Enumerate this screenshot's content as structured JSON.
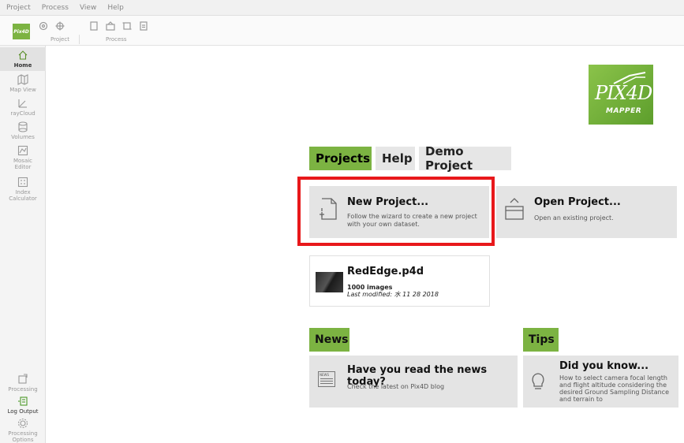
{
  "menubar": {
    "items": [
      "Project",
      "Process",
      "View",
      "Help"
    ]
  },
  "toolbar": {
    "groups": [
      {
        "label": "Project",
        "icons": [
          "tag-icon",
          "crosshair-icon"
        ]
      },
      {
        "label": "Process",
        "icons": [
          "page-icon",
          "folder-icon",
          "crop-icon",
          "report-icon"
        ]
      }
    ]
  },
  "sidebar": {
    "items": [
      {
        "label": "Home",
        "icon": "home-icon",
        "active": true
      },
      {
        "label": "Map View",
        "icon": "map-icon"
      },
      {
        "label": "rayCloud",
        "icon": "raycloud-icon"
      },
      {
        "label": "Volumes",
        "icon": "volume-icon"
      },
      {
        "label": "Mosaic Editor",
        "icon": "mosaic-icon"
      },
      {
        "label": "Index Calculator",
        "icon": "calculator-icon"
      }
    ],
    "bottom_items": [
      {
        "label": "Processing",
        "icon": "processing-icon"
      },
      {
        "label": "Log Output",
        "icon": "log-icon"
      },
      {
        "label": "Processing Options",
        "icon": "gear-icon"
      }
    ]
  },
  "logo": {
    "text": "PIX4D",
    "sub": "MAPPER",
    "color": "#7cb342"
  },
  "tabs": {
    "projects": "Projects",
    "help": "Help",
    "demo": "Demo Project"
  },
  "new_project": {
    "title": "New Project...",
    "desc": "Follow the wizard to create a new project with your own dataset."
  },
  "open_project": {
    "title": "Open Project...",
    "desc": "Open an existing project."
  },
  "recent_project": {
    "name": "RedEdge.p4d",
    "images": "1000 images",
    "modified": "Last modified: 水 11 28 2018"
  },
  "news": {
    "header": "News",
    "title": "Have you read the news today?",
    "desc": "Check the latest on Pix4D blog",
    "icon_text": "NEWS"
  },
  "tips": {
    "header": "Tips",
    "title": "Did you know...",
    "desc": "How to select camera focal length and flight altitude considering the desired Ground Sampling Distance and terrain to"
  },
  "colors": {
    "accent": "#7cb342",
    "highlight": "#e8181b"
  }
}
